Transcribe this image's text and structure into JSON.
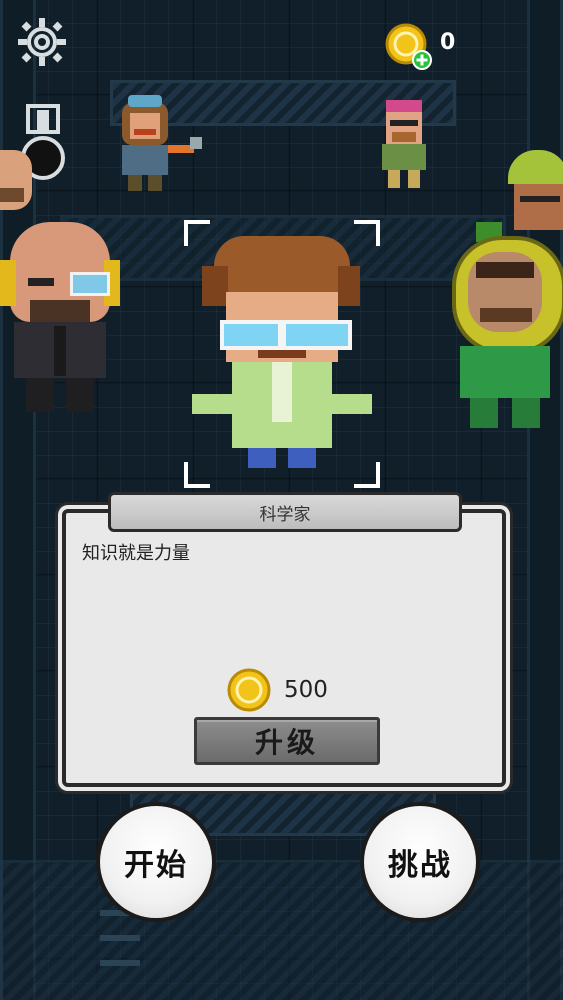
{
  "hud": {
    "settings_icon": "gear-icon",
    "achievements_icon": "medal-icon",
    "coins": "0",
    "coin_icon": "gold-coin-icon",
    "add_coin_icon": "plus-icon"
  },
  "selected_character": {
    "name": "科学家",
    "description": "知识就是力量",
    "upgrade_cost": "500",
    "upgrade_label": "升级"
  },
  "buttons": {
    "start_label": "开始",
    "challenge_label": "挑战"
  },
  "colors": {
    "coin": "#f2c318",
    "add_badge": "#27c23c",
    "panel_bg": "#e9e9e9",
    "upgrade_bg": "#7d7d7d"
  }
}
